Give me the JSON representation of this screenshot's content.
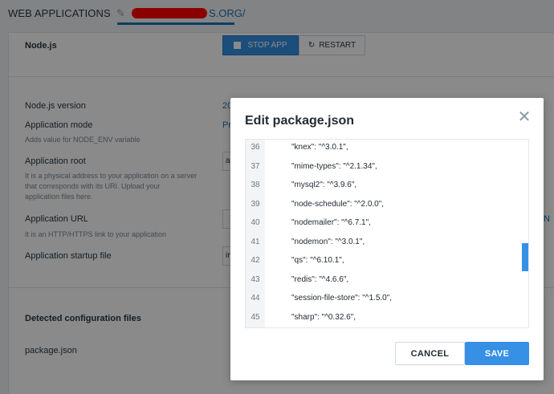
{
  "topbar": {
    "breadcrumb": "WEB APPLICATIONS",
    "domain_suffix": "S.ORG/"
  },
  "app_panel": {
    "app_name": "Node.js",
    "stop_label": "STOP APP",
    "restart_label": "RESTART"
  },
  "settings": {
    "version_label": "Node.js version",
    "version_value_peek": "20",
    "mode_label": "Application mode",
    "mode_sub": "Adds value for NODE_ENV variable",
    "mode_value_peek": "Pr",
    "root_label": "Application root",
    "root_sub_1": "It is a physical address to your application on a server",
    "root_sub_2": "that corresponds with its URI. Upload your",
    "root_sub_3": "application files here.",
    "root_value_peek": "a",
    "url_label": "Application URL",
    "url_sub": "It is an HTTP/HTTPS link to your application",
    "url_value_peek": "N",
    "startup_label": "Application startup file",
    "startup_value_peek": "in"
  },
  "config": {
    "heading": "Detected configuration files",
    "file_name": "package.json"
  },
  "modal": {
    "title": "Edit package.json",
    "lines": [
      {
        "num": "36",
        "text": "\"knex\": \"^3.0.1\","
      },
      {
        "num": "37",
        "text": "\"mime-types\": \"^2.1.34\","
      },
      {
        "num": "38",
        "text": "\"mysql2\": \"^3.9.6\","
      },
      {
        "num": "39",
        "text": "\"node-schedule\": \"^2.0.0\","
      },
      {
        "num": "40",
        "text": "\"nodemailer\": \"^6.7.1\","
      },
      {
        "num": "41",
        "text": "\"nodemon\": \"^3.0.1\","
      },
      {
        "num": "42",
        "text": "\"qs\": \"^6.10.1\","
      },
      {
        "num": "43",
        "text": "\"redis\": \"^4.6.6\","
      },
      {
        "num": "44",
        "text": "\"session-file-store\": \"^1.5.0\","
      },
      {
        "num": "45",
        "text": "\"sharp\": \"^0.32.6\","
      }
    ],
    "cancel_label": "CANCEL",
    "save_label": "SAVE"
  },
  "colors": {
    "accent": "#3590e6",
    "overlay": "#000000"
  }
}
